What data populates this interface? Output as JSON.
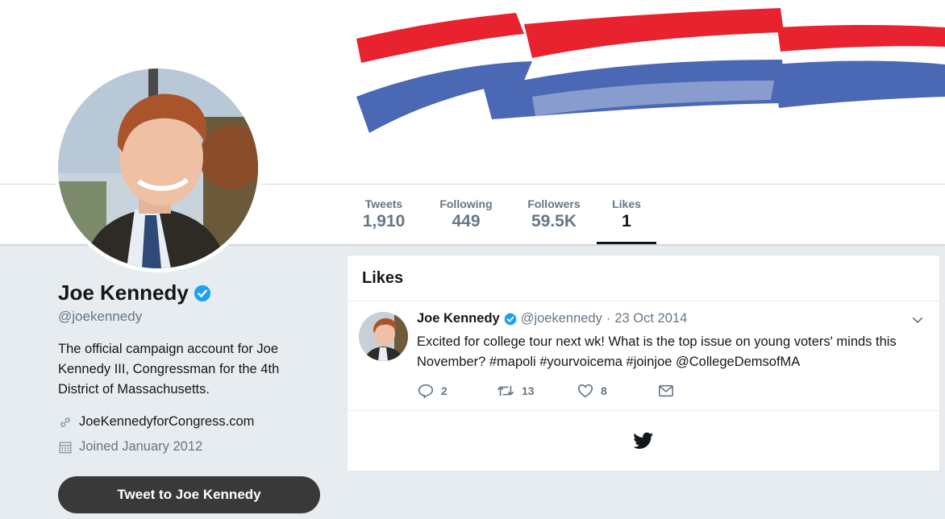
{
  "colors": {
    "accent": "#1da1f2",
    "banner_red": "#e8222e",
    "banner_blue": "#4b68b4",
    "button_dark": "#393939"
  },
  "nav": {
    "stats": [
      {
        "label": "Tweets",
        "value": "1,910"
      },
      {
        "label": "Following",
        "value": "449"
      },
      {
        "label": "Followers",
        "value": "59.5K"
      },
      {
        "label": "Likes",
        "value": "1"
      }
    ],
    "active": "Likes"
  },
  "profile": {
    "name": "Joe Kennedy",
    "verified": true,
    "handle": "@joekennedy",
    "bio": "The official campaign account for Joe Kennedy III, Congressman for the 4th District of Massachusetts.",
    "website": "JoeKennedyforCongress.com",
    "joined": "Joined January 2012",
    "tweet_to_label": "Tweet to Joe Kennedy"
  },
  "likes_panel": {
    "title": "Likes",
    "tweet": {
      "name": "Joe Kennedy",
      "handle": "@joekennedy",
      "separator": "·",
      "date": "23 Oct 2014",
      "text": "Excited for college tour next wk! What is the top issue on young voters' minds this November? #mapoli #yourvoicema #joinjoe @CollegeDemsofMA",
      "replies": "2",
      "retweets": "13",
      "likes": "8"
    }
  },
  "icons": {
    "verified": "verified-badge-icon",
    "link": "link-icon",
    "calendar": "calendar-icon",
    "caret": "chevron-down-icon",
    "reply": "reply-icon",
    "retweet": "retweet-icon",
    "like": "heart-icon",
    "message": "envelope-icon",
    "logo": "twitter-bird-icon"
  }
}
